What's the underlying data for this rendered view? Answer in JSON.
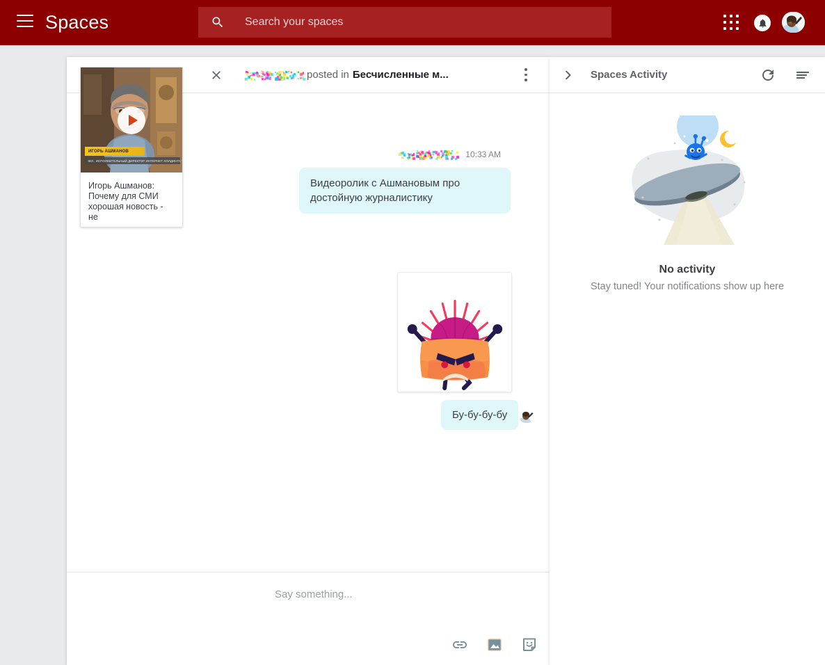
{
  "appbar": {
    "menu_icon": "hamburger-menu-icon",
    "brand": "Spaces",
    "search": {
      "placeholder": "Search your spaces",
      "icon": "search-icon"
    },
    "apps_icon": "apps-grid-icon",
    "notifications_icon": "bell-icon",
    "avatar": "user-avatar",
    "bg_color": "#8C0000",
    "search_bg_color": "#A62222"
  },
  "conversation": {
    "close_icon": "close-icon",
    "author_redacted": "",
    "posted_label": "posted in",
    "space_name": "Бесчисленные м...",
    "overflow_icon": "more-vertical-icon",
    "timestamp": "10:33 AM",
    "messages": [
      {
        "type": "text",
        "text": "Видеоролик с Ашмановым про достойную журналистику",
        "bubble_color": "#E0F7FA"
      },
      {
        "type": "sticker",
        "name": "angry-character-sticker"
      },
      {
        "type": "text",
        "text": "Бу-бу-бу-бу",
        "bubble_color": "#E0F7FA"
      }
    ],
    "composer": {
      "placeholder": "Say something...",
      "icons": [
        "link-icon",
        "image-icon",
        "sticker-icon"
      ]
    }
  },
  "video_card": {
    "play_icon": "play-button-icon",
    "caption_name": "ИГОРЬ АШМАНОВ",
    "caption_role": "ЭКС. ИСПОЛНИТЕЛЬНЫЙ ДИРЕКТОР ИНТЕРНЕТ-ХОЛДИНГА \"РАМБЛЕР\"",
    "title": "Игорь Ашманов: Почему для СМИ хорошая новость - не"
  },
  "activity_panel": {
    "expand_icon": "chevron-right-icon",
    "title": "Spaces Activity",
    "refresh_icon": "refresh-icon",
    "filter_icon": "filter-list-icon",
    "empty_illustration": "ufo-alien-illustration",
    "empty_title": "No activity",
    "empty_subtitle": "Stay tuned! Your notifications show up here"
  },
  "page": {
    "bg_color": "#E8EAED"
  }
}
